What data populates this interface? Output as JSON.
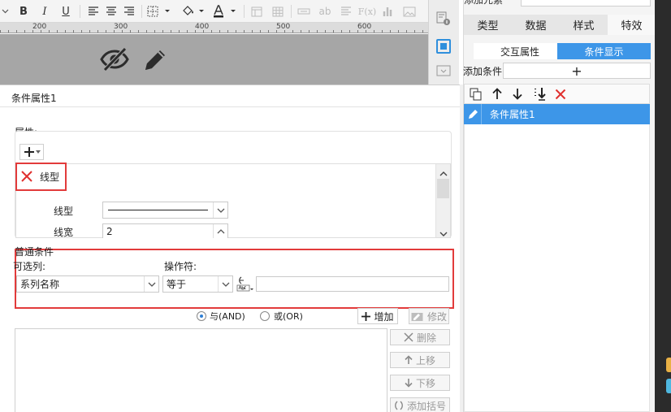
{
  "toolbar": {
    "bold_label": "B",
    "italic_label": "I",
    "underline_label": "U",
    "fx_label": "F(x)",
    "ab_label": "ab"
  },
  "ruler": {
    "labels": [
      "200",
      "300",
      "400",
      "500",
      "600"
    ]
  },
  "dialog": {
    "title": "条件属性1",
    "attr_label": "属性:",
    "attribute_item": "线型",
    "line_type_label": "线型",
    "line_width_label": "线宽",
    "line_width_value": "2",
    "normal_condition_label": "普通条件",
    "optional_column_label": "可选列:",
    "operator_label": "操作符:",
    "column_value": "系列名称",
    "operator_value": "等于",
    "value_input": "",
    "and_label": "与(AND)",
    "or_label": "或(OR)",
    "add_button": "增加",
    "modify_button": "修改",
    "delete_button": "删除",
    "move_up_button": "上移",
    "move_down_button": "下移",
    "add_bracket_button": "添加括号"
  },
  "right_panel": {
    "partial_header": "添加元素",
    "tabs": [
      "类型",
      "数据",
      "样式",
      "特效"
    ],
    "subtabs": [
      "交互属性",
      "条件显示"
    ],
    "add_condition_label": "添加条件",
    "add_symbol": "+",
    "condition_items": [
      "条件属性1"
    ]
  },
  "colors": {
    "accent_blue": "#3d96e8",
    "highlight_red": "#e23b3b",
    "delete_red": "#e0302e",
    "canvas_gray": "#a6a6a6"
  }
}
